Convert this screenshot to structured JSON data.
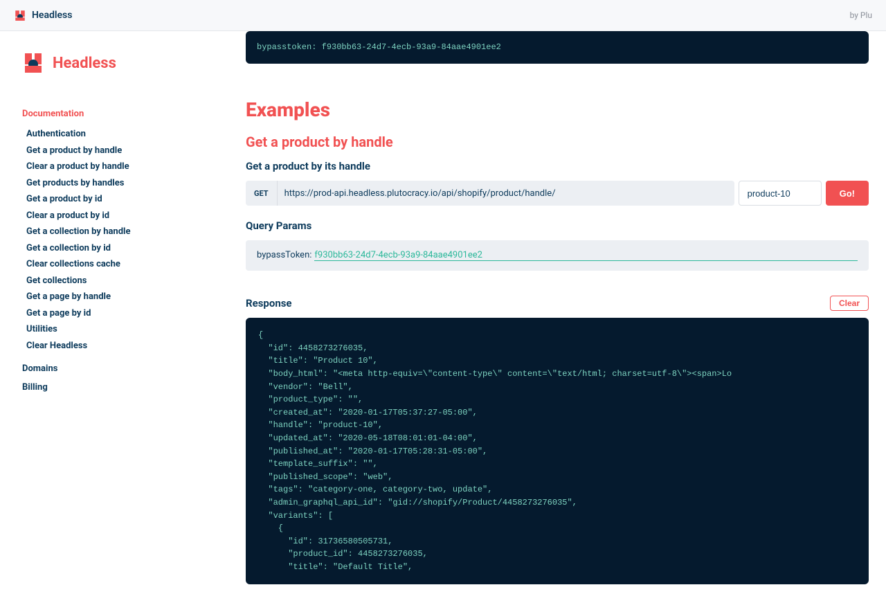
{
  "topbar": {
    "title": "Headless",
    "byline": "by Plu"
  },
  "sidebar": {
    "brand": "Headless",
    "section": "Documentation",
    "items": [
      "Authentication",
      "Get a product by handle",
      "Clear a product by handle",
      "Get products by handles",
      "Get a product by id",
      "Clear a product by id",
      "Get a collection by handle",
      "Get a collection by id",
      "Clear collections cache",
      "Get collections",
      "Get a page by handle",
      "Get a page by id",
      "Utilities",
      "Clear Headless"
    ],
    "extra": [
      "Domains",
      "Billing"
    ]
  },
  "top_code": "bypasstoken: f930bb63-24d7-4ecb-93a9-84aae4901ee2",
  "examples_heading": "Examples",
  "endpoint_heading": "Get a product by handle",
  "endpoint_sub": "Get a product by its handle",
  "method": "GET",
  "url": "https://prod-api.headless.plutocracy.io/api/shopify/product/handle/",
  "handle_value": "product-10",
  "go_label": "Go!",
  "query_params_heading": "Query Params",
  "param_key": "bypassToken:",
  "param_value": "f930bb63-24d7-4ecb-93a9-84aae4901ee2",
  "response_heading": "Response",
  "clear_label": "Clear",
  "response_body": "{\n  \"id\": 4458273276035,\n  \"title\": \"Product 10\",\n  \"body_html\": \"<meta http-equiv=\\\"content-type\\\" content=\\\"text/html; charset=utf-8\\\"><span>Lo\n  \"vendor\": \"Bell\",\n  \"product_type\": \"\",\n  \"created_at\": \"2020-01-17T05:37:27-05:00\",\n  \"handle\": \"product-10\",\n  \"updated_at\": \"2020-05-18T08:01:01-04:00\",\n  \"published_at\": \"2020-01-17T05:28:31-05:00\",\n  \"template_suffix\": \"\",\n  \"published_scope\": \"web\",\n  \"tags\": \"category-one, category-two, update\",\n  \"admin_graphql_api_id\": \"gid://shopify/Product/4458273276035\",\n  \"variants\": [\n    {\n      \"id\": 31736580505731,\n      \"product_id\": 4458273276035,\n      \"title\": \"Default Title\","
}
